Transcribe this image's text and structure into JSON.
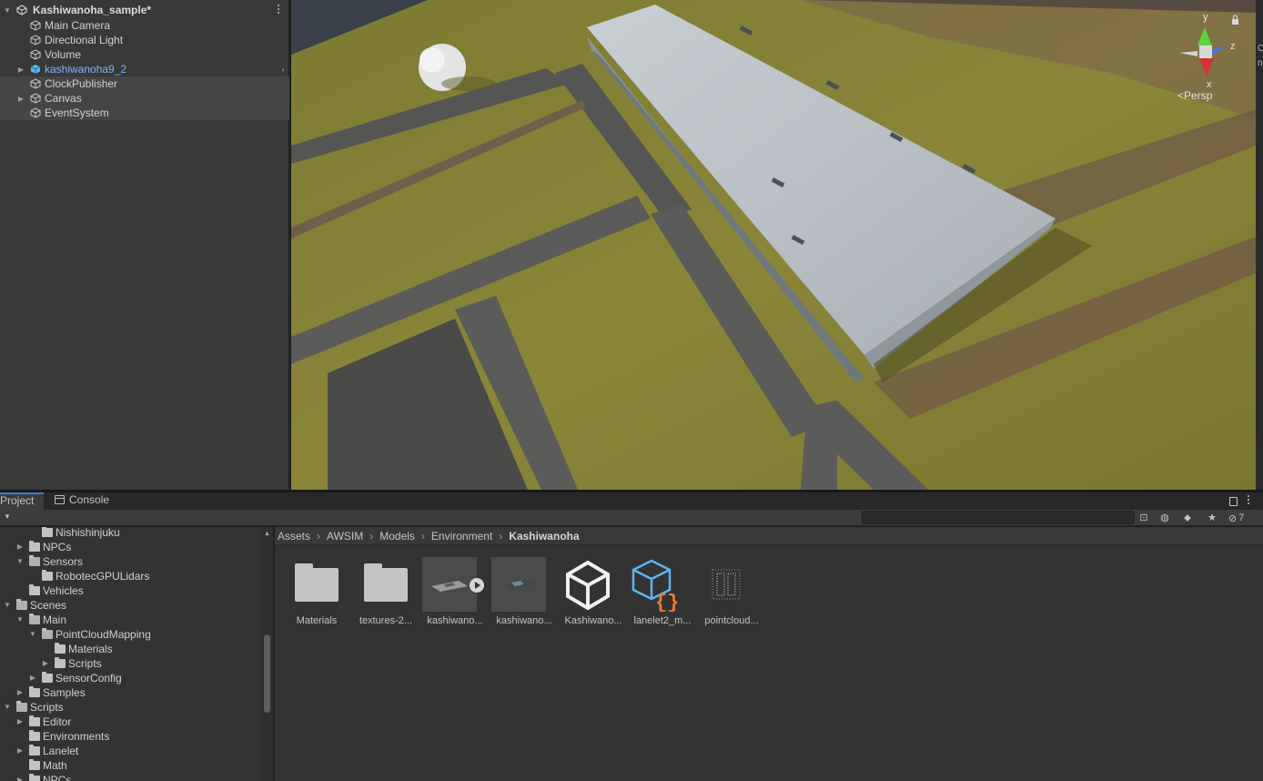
{
  "hierarchy": {
    "scene_name": "Kashiwanoha_sample*",
    "items": [
      {
        "label": "Main Camera"
      },
      {
        "label": "Directional Light"
      },
      {
        "label": "Volume"
      },
      {
        "label": "kashiwanoha9_2"
      },
      {
        "label": "ClockPublisher"
      },
      {
        "label": "Canvas"
      },
      {
        "label": "EventSystem"
      }
    ]
  },
  "scene_view": {
    "gizmo": {
      "axis_y": "y",
      "axis_z": "z",
      "axis_x": "x",
      "projection": "Persp"
    },
    "edge_text": [
      "C",
      "n"
    ]
  },
  "bottom_panel": {
    "tabs": [
      {
        "label": "Project"
      },
      {
        "label": "Console"
      }
    ],
    "search": {
      "value": "",
      "placeholder": ""
    },
    "hidden_packages_count": "7"
  },
  "folder_tree": {
    "items": [
      {
        "label": "Nishishinjuku"
      },
      {
        "label": "NPCs"
      },
      {
        "label": "Sensors"
      },
      {
        "label": "RobotecGPULidars"
      },
      {
        "label": "Vehicles"
      },
      {
        "label": "Scenes"
      },
      {
        "label": "Main"
      },
      {
        "label": "PointCloudMapping"
      },
      {
        "label": "Materials"
      },
      {
        "label": "Scripts"
      },
      {
        "label": "SensorConfig"
      },
      {
        "label": "Samples"
      },
      {
        "label": "Scripts"
      },
      {
        "label": "Editor"
      },
      {
        "label": "Environments"
      },
      {
        "label": "Lanelet"
      },
      {
        "label": "Math"
      },
      {
        "label": "NPCs"
      }
    ]
  },
  "breadcrumb": [
    "Assets",
    "AWSIM",
    "Models",
    "Environment",
    "Kashiwanoha"
  ],
  "assets": [
    {
      "name": "Materials"
    },
    {
      "name": "textures-2..."
    },
    {
      "name": "kashiwano..."
    },
    {
      "name": "kashiwano..."
    },
    {
      "name": "Kashiwano..."
    },
    {
      "name": "lanelet2_m..."
    },
    {
      "name": "pointcloud..."
    }
  ],
  "colors": {
    "prefab_text": "#7cb4ff",
    "active_tab_accent": "#3a79d9",
    "lanelet_icon": "#5ab6f0",
    "lanelet_braces": "#f07a36"
  }
}
